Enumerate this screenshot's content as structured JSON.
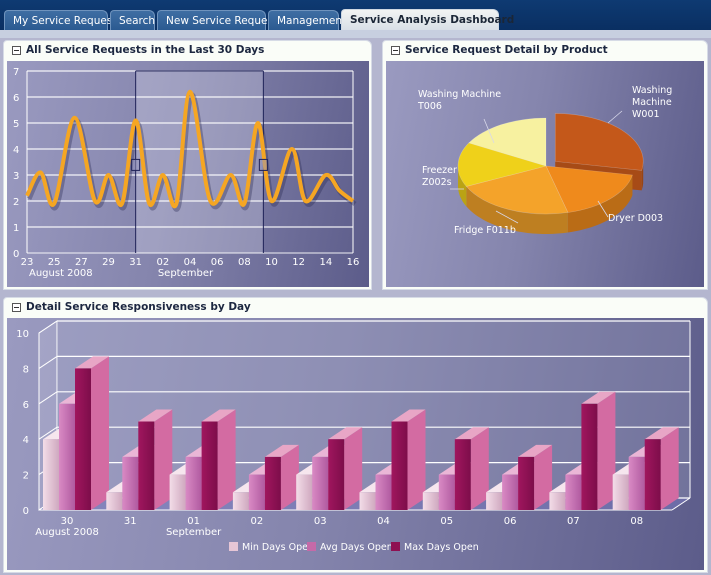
{
  "tabs": [
    {
      "label": "My Service Requests",
      "active": false
    },
    {
      "label": "Search",
      "active": false
    },
    {
      "label": "New Service Request",
      "active": false
    },
    {
      "label": "Management",
      "active": false
    },
    {
      "label": "Service Analysis Dashboard",
      "active": true
    }
  ],
  "panels": {
    "requests": {
      "title": "All Service Requests in the Last 30 Days"
    },
    "product": {
      "title": "Service Request Detail by Product"
    },
    "responsiveness": {
      "title": "Detail Service Responsiveness by Day"
    }
  },
  "colors": {
    "line": "#f5a623",
    "pie": [
      "#c4581a",
      "#ef8a1c",
      "#f4a32a",
      "#efd11a",
      "#f7f1a0"
    ],
    "bars": [
      "#e6c6d6",
      "#c56aa8",
      "#8e1052"
    ]
  },
  "chart_data": [
    {
      "type": "line",
      "title": "All Service Requests in the Last 30 Days",
      "xlabel": "",
      "ylabel": "",
      "ylim": [
        0,
        7
      ],
      "yticks": [
        "0",
        "1",
        "2",
        "3",
        "4",
        "5",
        "6",
        "7"
      ],
      "x_tick_labels": [
        "23",
        "25",
        "27",
        "29",
        "31",
        "02",
        "04",
        "06",
        "08",
        "10",
        "12",
        "14",
        "16"
      ],
      "x_group_labels": [
        {
          "label": "August 2008",
          "at": 0
        },
        {
          "label": "September",
          "at": 5
        }
      ],
      "grid": true,
      "selection_range": [
        "Aug 31",
        "Sep 09"
      ],
      "series": [
        {
          "name": "Service Requests",
          "x": [
            0,
            1,
            2,
            3.5,
            5,
            6,
            7,
            8,
            9,
            10,
            11,
            12,
            13.5,
            15,
            16,
            17,
            18,
            19.5,
            20.5,
            22,
            23,
            24
          ],
          "y": [
            2.2,
            3.1,
            1.9,
            5.2,
            2.0,
            3.0,
            1.9,
            5.1,
            1.9,
            3.0,
            1.9,
            6.2,
            2.0,
            3.0,
            1.9,
            5.0,
            2.0,
            4.0,
            2.0,
            3.0,
            2.4,
            2.0
          ]
        }
      ]
    },
    {
      "type": "pie",
      "title": "Service Request Detail by Product",
      "slices": [
        {
          "label": "Washing Machine W001",
          "value": 28,
          "exploded": true
        },
        {
          "label": "Dryer D003",
          "value": 18
        },
        {
          "label": "Fridge F011b",
          "value": 22
        },
        {
          "label": "Freezer Z002s",
          "value": 15
        },
        {
          "label": "Washing Machine T006",
          "value": 17
        }
      ]
    },
    {
      "type": "bar",
      "title": "Detail Service Responsiveness by Day",
      "categories": [
        "30",
        "31",
        "01",
        "02",
        "03",
        "04",
        "05",
        "06",
        "07",
        "08"
      ],
      "category_group_labels": [
        {
          "label": "August 2008",
          "at": 0
        },
        {
          "label": "September",
          "at": 2
        }
      ],
      "ylim": [
        0,
        10
      ],
      "yticks": [
        "0",
        "2",
        "4",
        "6",
        "8",
        "10"
      ],
      "grid": true,
      "legend_position": "bottom",
      "series": [
        {
          "name": "Min Days Open",
          "values": [
            4,
            1,
            2,
            1,
            2,
            1,
            1,
            1,
            1,
            2
          ]
        },
        {
          "name": "Avg Days Open",
          "values": [
            6,
            3,
            3,
            2,
            3,
            2,
            2,
            2,
            2,
            3
          ]
        },
        {
          "name": "Max Days Open",
          "values": [
            8,
            5,
            5,
            3,
            4,
            5,
            4,
            3,
            6,
            4
          ]
        }
      ]
    }
  ]
}
